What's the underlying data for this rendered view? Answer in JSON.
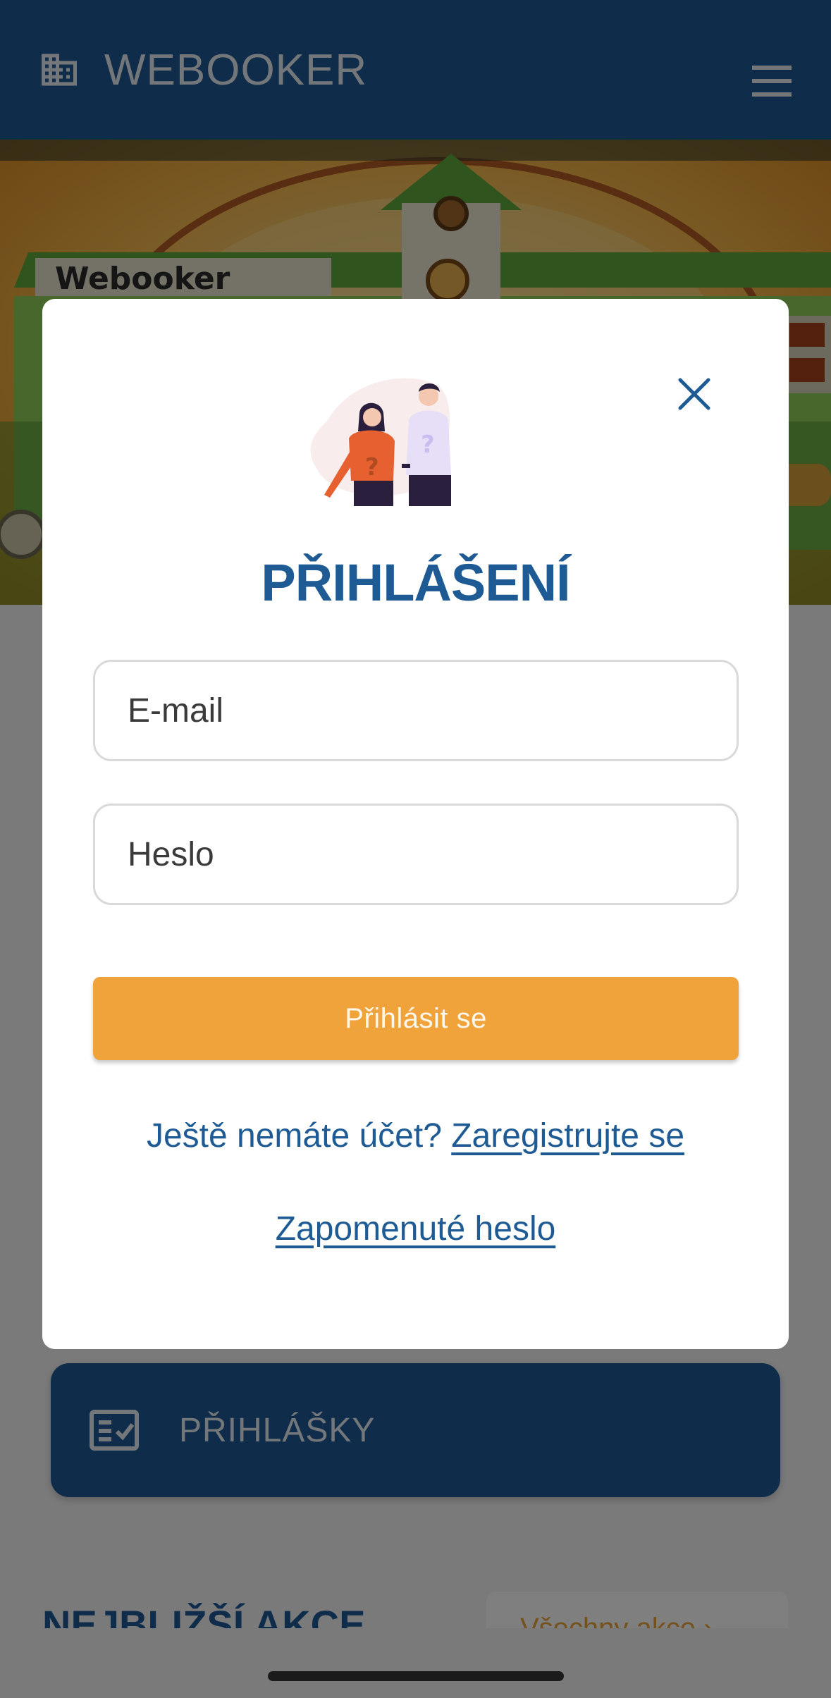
{
  "header": {
    "brand_name": "WEBOOKER",
    "brand_icon": "building-icon",
    "menu_icon": "hamburger-menu-icon",
    "bar_color": "#1e5b94"
  },
  "hero": {
    "sign_text": "Webooker"
  },
  "page": {
    "registrations_card_label": "PŘIHLÁŠKY",
    "registrations_card_icon": "checklist-icon",
    "section_title": "NEJBLIŽŠÍ AKCE",
    "all_events_label": "Všechny akce  ›"
  },
  "modal": {
    "title": "PŘIHLÁŠENÍ",
    "close_icon": "close-icon",
    "illustration": "couple-question-illustration",
    "email_placeholder": "E-mail",
    "password_placeholder": "Heslo",
    "login_button_label": "Přihlásit se",
    "signup_prompt": "Ještě nemáte účet? ",
    "signup_link_label": "Zaregistrujte se",
    "forgot_password_label": "Zapomenuté heslo",
    "accent_color": "#1e5b94",
    "button_color": "#f0a33a"
  }
}
